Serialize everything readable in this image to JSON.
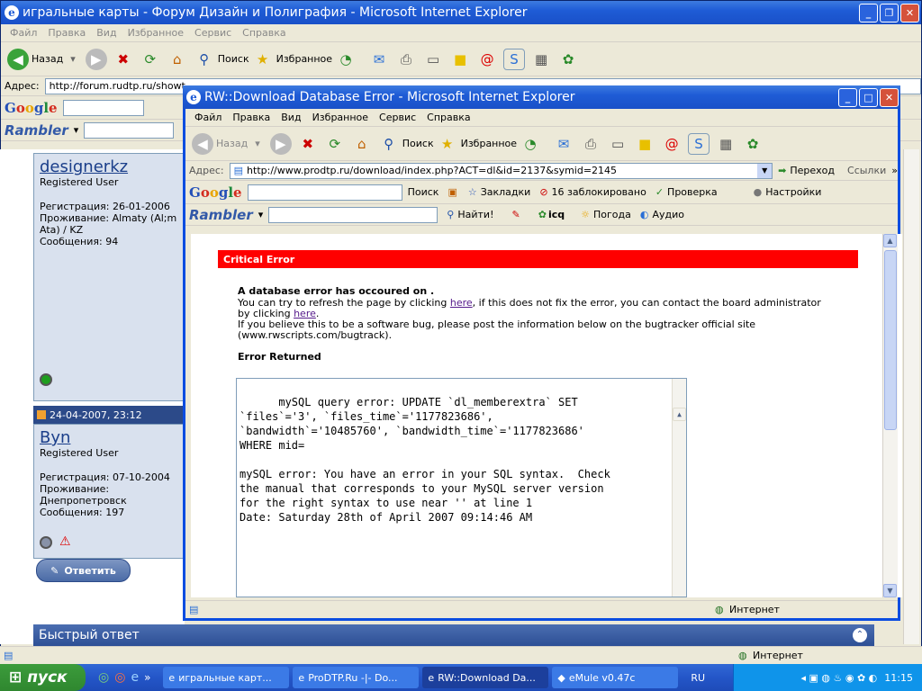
{
  "bg_window": {
    "title": "игральные карты - Форум Дизайн и Полиграфия - Microsoft Internet Explorer",
    "menu": [
      "Файл",
      "Правка",
      "Вид",
      "Избранное",
      "Сервис",
      "Справка"
    ],
    "back_label": "Назад",
    "search_label": "Поиск",
    "favorites_label": "Избранное",
    "address_label": "Адрес:",
    "address_value": "http://forum.rudtp.ru/showt",
    "status_zone": "Интернет",
    "posts": [
      {
        "username": "designerkz",
        "role": "Registered User",
        "reg": "Регистрация: 26-01-2006",
        "location": "Проживание: Almaty (Al;m Ata) / KZ",
        "messages": "Сообщения: 94"
      },
      {
        "date": "24-04-2007, 23:12",
        "username": "Byn",
        "role": "Registered User",
        "reg": "Регистрация: 07-10-2004",
        "location": "Проживание: Днепропетровск",
        "messages": "Сообщения: 197"
      }
    ],
    "reply_button": "Ответить",
    "quick_reply": "Быстрый ответ"
  },
  "fg_window": {
    "title": "RW::Download Database Error - Microsoft Internet Explorer",
    "menu": [
      "Файл",
      "Правка",
      "Вид",
      "Избранное",
      "Сервис",
      "Справка"
    ],
    "back_label": "Назад",
    "search_label": "Поиск",
    "favorites_label": "Избранное",
    "address_label": "Адрес:",
    "address_value": "http://www.prodtp.ru/download/index.php?ACT=dl&id=2137&symid=2145",
    "go_label": "Переход",
    "links_label": "Ссылки",
    "google": {
      "search": "Поиск",
      "bookmarks": "Закладки",
      "blocked": "16 заблокировано",
      "check": "Проверка",
      "settings": "Настройки"
    },
    "rambler": {
      "find": "Найти!",
      "icq": "icq",
      "weather": "Погода",
      "audio": "Аудио"
    },
    "error": {
      "header": "Critical Error",
      "title": "A database error has occoured on .",
      "line1_pre": "You can try to refresh the page by clicking ",
      "line1_link": "here",
      "line1_post": ", if this does not fix the error, you can contact the board administrator",
      "line2_pre": "by clicking ",
      "line2_link": "here",
      "line2_post": ".",
      "line3": "If you believe this to be a software bug, please post the information below on the bugtracker official site",
      "line4": "(www.rwscripts.com/bugtrack).",
      "returned_label": "Error Returned",
      "sql_text": "mySQL query error: UPDATE `dl_memberextra` SET\n`files`='3', `files_time`='1177823686',\n`bandwidth`='10485760', `bandwidth_time`='1177823686'\nWHERE mid=\n\nmySQL error: You have an error in your SQL syntax.  Check\nthe manual that corresponds to your MySQL server version\nfor the right syntax to use near '' at line 1\nDate: Saturday 28th of April 2007 09:14:46 AM"
    },
    "status_zone": "Интернет"
  },
  "taskbar": {
    "start": "пуск",
    "tasks": [
      "игральные карт...",
      "ProDTP.Ru -|- Do...",
      "RW::Download Da...",
      "eMule v0.47c"
    ],
    "lang": "RU",
    "clock": "11:15"
  },
  "colors": {
    "error_header": "#ff0000",
    "xp_blue": "#1f5cd6",
    "taskbar": "#2456c8",
    "start": "#2f872f"
  }
}
